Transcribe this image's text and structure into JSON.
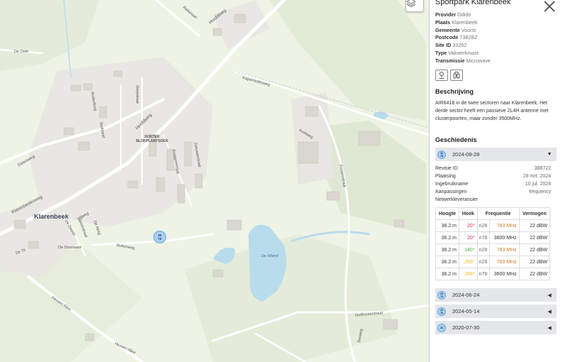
{
  "map": {
    "place": "Klarenbeek",
    "poi": "DOKTER BLOKPLANTSOEN",
    "water": "De Wiend",
    "streets": [
      "Hoofdweg",
      "Hoofdweg",
      "Kruisenstraat",
      "Kapermolenweg",
      "Klarenbeeksweg",
      "Elsbosweg",
      "Hessen Allee",
      "Hessen Allee",
      "De Doorvaart",
      "Buitenweg",
      "De Oele",
      "De Til",
      "Reikelaan",
      "De Zwaan",
      "Spoorstraat",
      "Vrijweg",
      "De Atlag",
      "Oudhuizerstraat",
      "Bosweg",
      "Rodenburg",
      "Stuifzand",
      "Dorpstraat",
      "Zeeuwerstraat",
      "Kerkweg",
      "Kraaymeergat"
    ],
    "marker_badge": [
      "26",
      "78"
    ]
  },
  "panel": {
    "title": "Sportpark Klarenbeek",
    "close_icon": "close-icon",
    "fields": [
      {
        "label": "Provider",
        "value": "Odido"
      },
      {
        "label": "Plaats",
        "value": "Klarenbeek"
      },
      {
        "label": "Gemeente",
        "value": "Voorst"
      },
      {
        "label": "Postcode",
        "value": "7382BZ"
      },
      {
        "label": "Site ID",
        "value": "33262"
      },
      {
        "label": "Type",
        "value": "Vakwerkmast"
      },
      {
        "label": "Transmissie",
        "value": "Microwave"
      }
    ],
    "description_heading": "Beschrijving",
    "description": "AIR6418 in de twee sectoren naar Klarenbeek. Het derde sector heeft een passieve 2L4H antenne met clusterpoorten, maar zonder 3500MHz.",
    "history_heading": "Geschiedenis",
    "history": [
      {
        "date": "2024-08-28",
        "badge": [
          "26",
          "78"
        ],
        "expanded": true
      },
      {
        "date": "2024-06-24",
        "badge": [
          "26",
          "78"
        ],
        "expanded": false
      },
      {
        "date": "2024-05-14",
        "badge": [
          "26",
          "78"
        ],
        "expanded": false
      },
      {
        "date": "2020-07-30",
        "badge": [
          "26"
        ],
        "expanded": false
      }
    ],
    "details": [
      {
        "label": "Revisie ID",
        "value": "388722"
      },
      {
        "label": "Plaatsing",
        "value": "28 mrt. 2024"
      },
      {
        "label": "Ingebruikname",
        "value": "10 jul. 2024"
      },
      {
        "label": "Aanpassingen",
        "value": "frequency"
      },
      {
        "label": "Netwerkleverancier",
        "value": ""
      }
    ],
    "table": {
      "headers": [
        "Hoogte",
        "Hoek",
        "Frequentie",
        "Vermogen"
      ],
      "rows": [
        {
          "hoogte": "36.2 m",
          "hoek": "20°",
          "band": "n28",
          "freq": "783 MHz",
          "vermogen": "22 dBW",
          "hoek_color": "#e0303c",
          "freq_color": "#d07a1e"
        },
        {
          "hoogte": "36.2 m",
          "hoek": "20°",
          "band": "n78",
          "freq": "3600 MHz",
          "vermogen": "22 dBW",
          "hoek_color": "#e0303c",
          "freq_color": "#333333"
        },
        {
          "hoogte": "36.2 m",
          "hoek": "140°",
          "band": "n28",
          "freq": "783 MHz",
          "vermogen": "22 dBW",
          "hoek_color": "#3db34a",
          "freq_color": "#d07a1e"
        },
        {
          "hoogte": "36.2 m",
          "hoek": "268°",
          "band": "n28",
          "freq": "783 MHz",
          "vermogen": "22 dBW",
          "hoek_color": "#e3c21c",
          "freq_color": "#d07a1e"
        },
        {
          "hoogte": "36.2 m",
          "hoek": "268°",
          "band": "n78",
          "freq": "3600 MHz",
          "vermogen": "22 dBW",
          "hoek_color": "#e3c21c",
          "freq_color": "#333333"
        }
      ]
    }
  }
}
